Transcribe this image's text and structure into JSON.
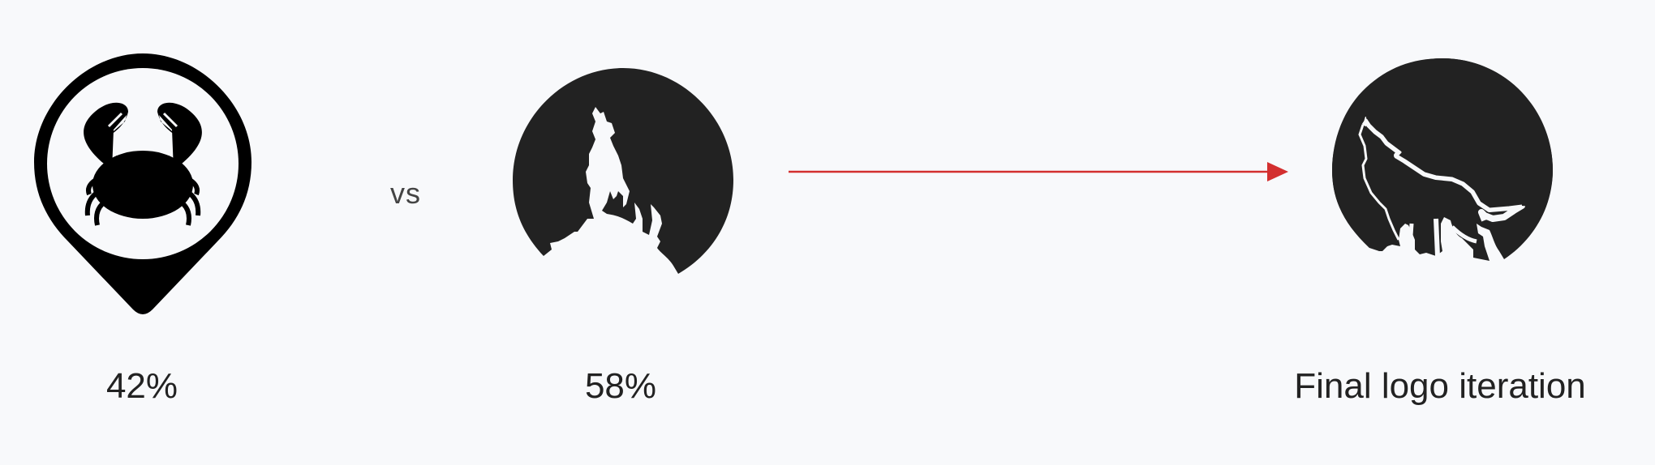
{
  "comparison": {
    "vs_label": "vs",
    "left_percentage": "42%",
    "middle_percentage": "58%",
    "final_caption": "Final logo iteration"
  },
  "icons": {
    "left_logo": "crab-location-pin-icon",
    "middle_logo": "howling-wolf-moon-icon",
    "final_logo": "howling-wolf-moon-icon",
    "arrow": "arrow-right-icon"
  },
  "colors": {
    "background": "#f8f9fb",
    "logo_fill": "#222222",
    "pin_fill": "#000000",
    "arrow": "#d32f2f"
  }
}
